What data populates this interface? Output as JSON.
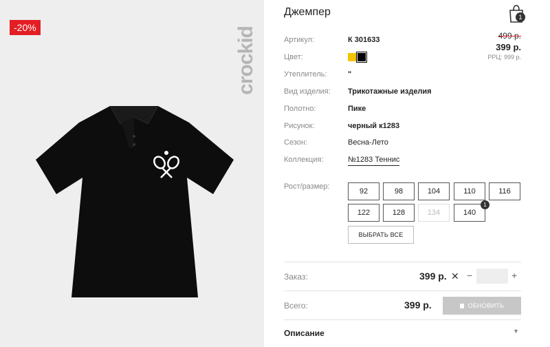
{
  "product": {
    "title": "Джемпер",
    "discount_badge": "-20%",
    "brand": "crockid",
    "old_price": "499 р.",
    "new_price": "399 р.",
    "rrc": "РРЦ: 999 р.",
    "cart_count": "1"
  },
  "attributes": [
    {
      "label": "Артикул:",
      "value": "К 301633"
    },
    {
      "label": "Цвет:",
      "value": ""
    },
    {
      "label": "Утеплитель:",
      "value": "\""
    },
    {
      "label": "Вид изделия:",
      "value": "Трикотажные изделия"
    },
    {
      "label": "Полотно:",
      "value": "Пике"
    },
    {
      "label": "Рисунок:",
      "value": "черный к1283"
    },
    {
      "label": "Сезон:",
      "value": "Весна-Лето"
    },
    {
      "label": "Коллекция:",
      "value": "№1283 Теннис"
    }
  ],
  "colors": {
    "swatch_yellow": "#f5c400",
    "swatch_black": "#000000",
    "discount": "#e31e24"
  },
  "sizes": {
    "label": "Рост/размер:",
    "items": [
      "92",
      "98",
      "104",
      "110",
      "116",
      "122",
      "128",
      "134",
      "140"
    ],
    "selected_badge": "1",
    "select_all": "ВЫБРАТЬ ВСЕ"
  },
  "order": {
    "label": "Заказ:",
    "price": "399 р.",
    "clear": "✕",
    "minus": "−",
    "plus": "+",
    "quantity": ""
  },
  "total": {
    "label": "Всего:",
    "price": "399 р.",
    "update_button": "ОБНОВИТЬ"
  },
  "description": {
    "label": "Описание",
    "chevron": "▼"
  }
}
